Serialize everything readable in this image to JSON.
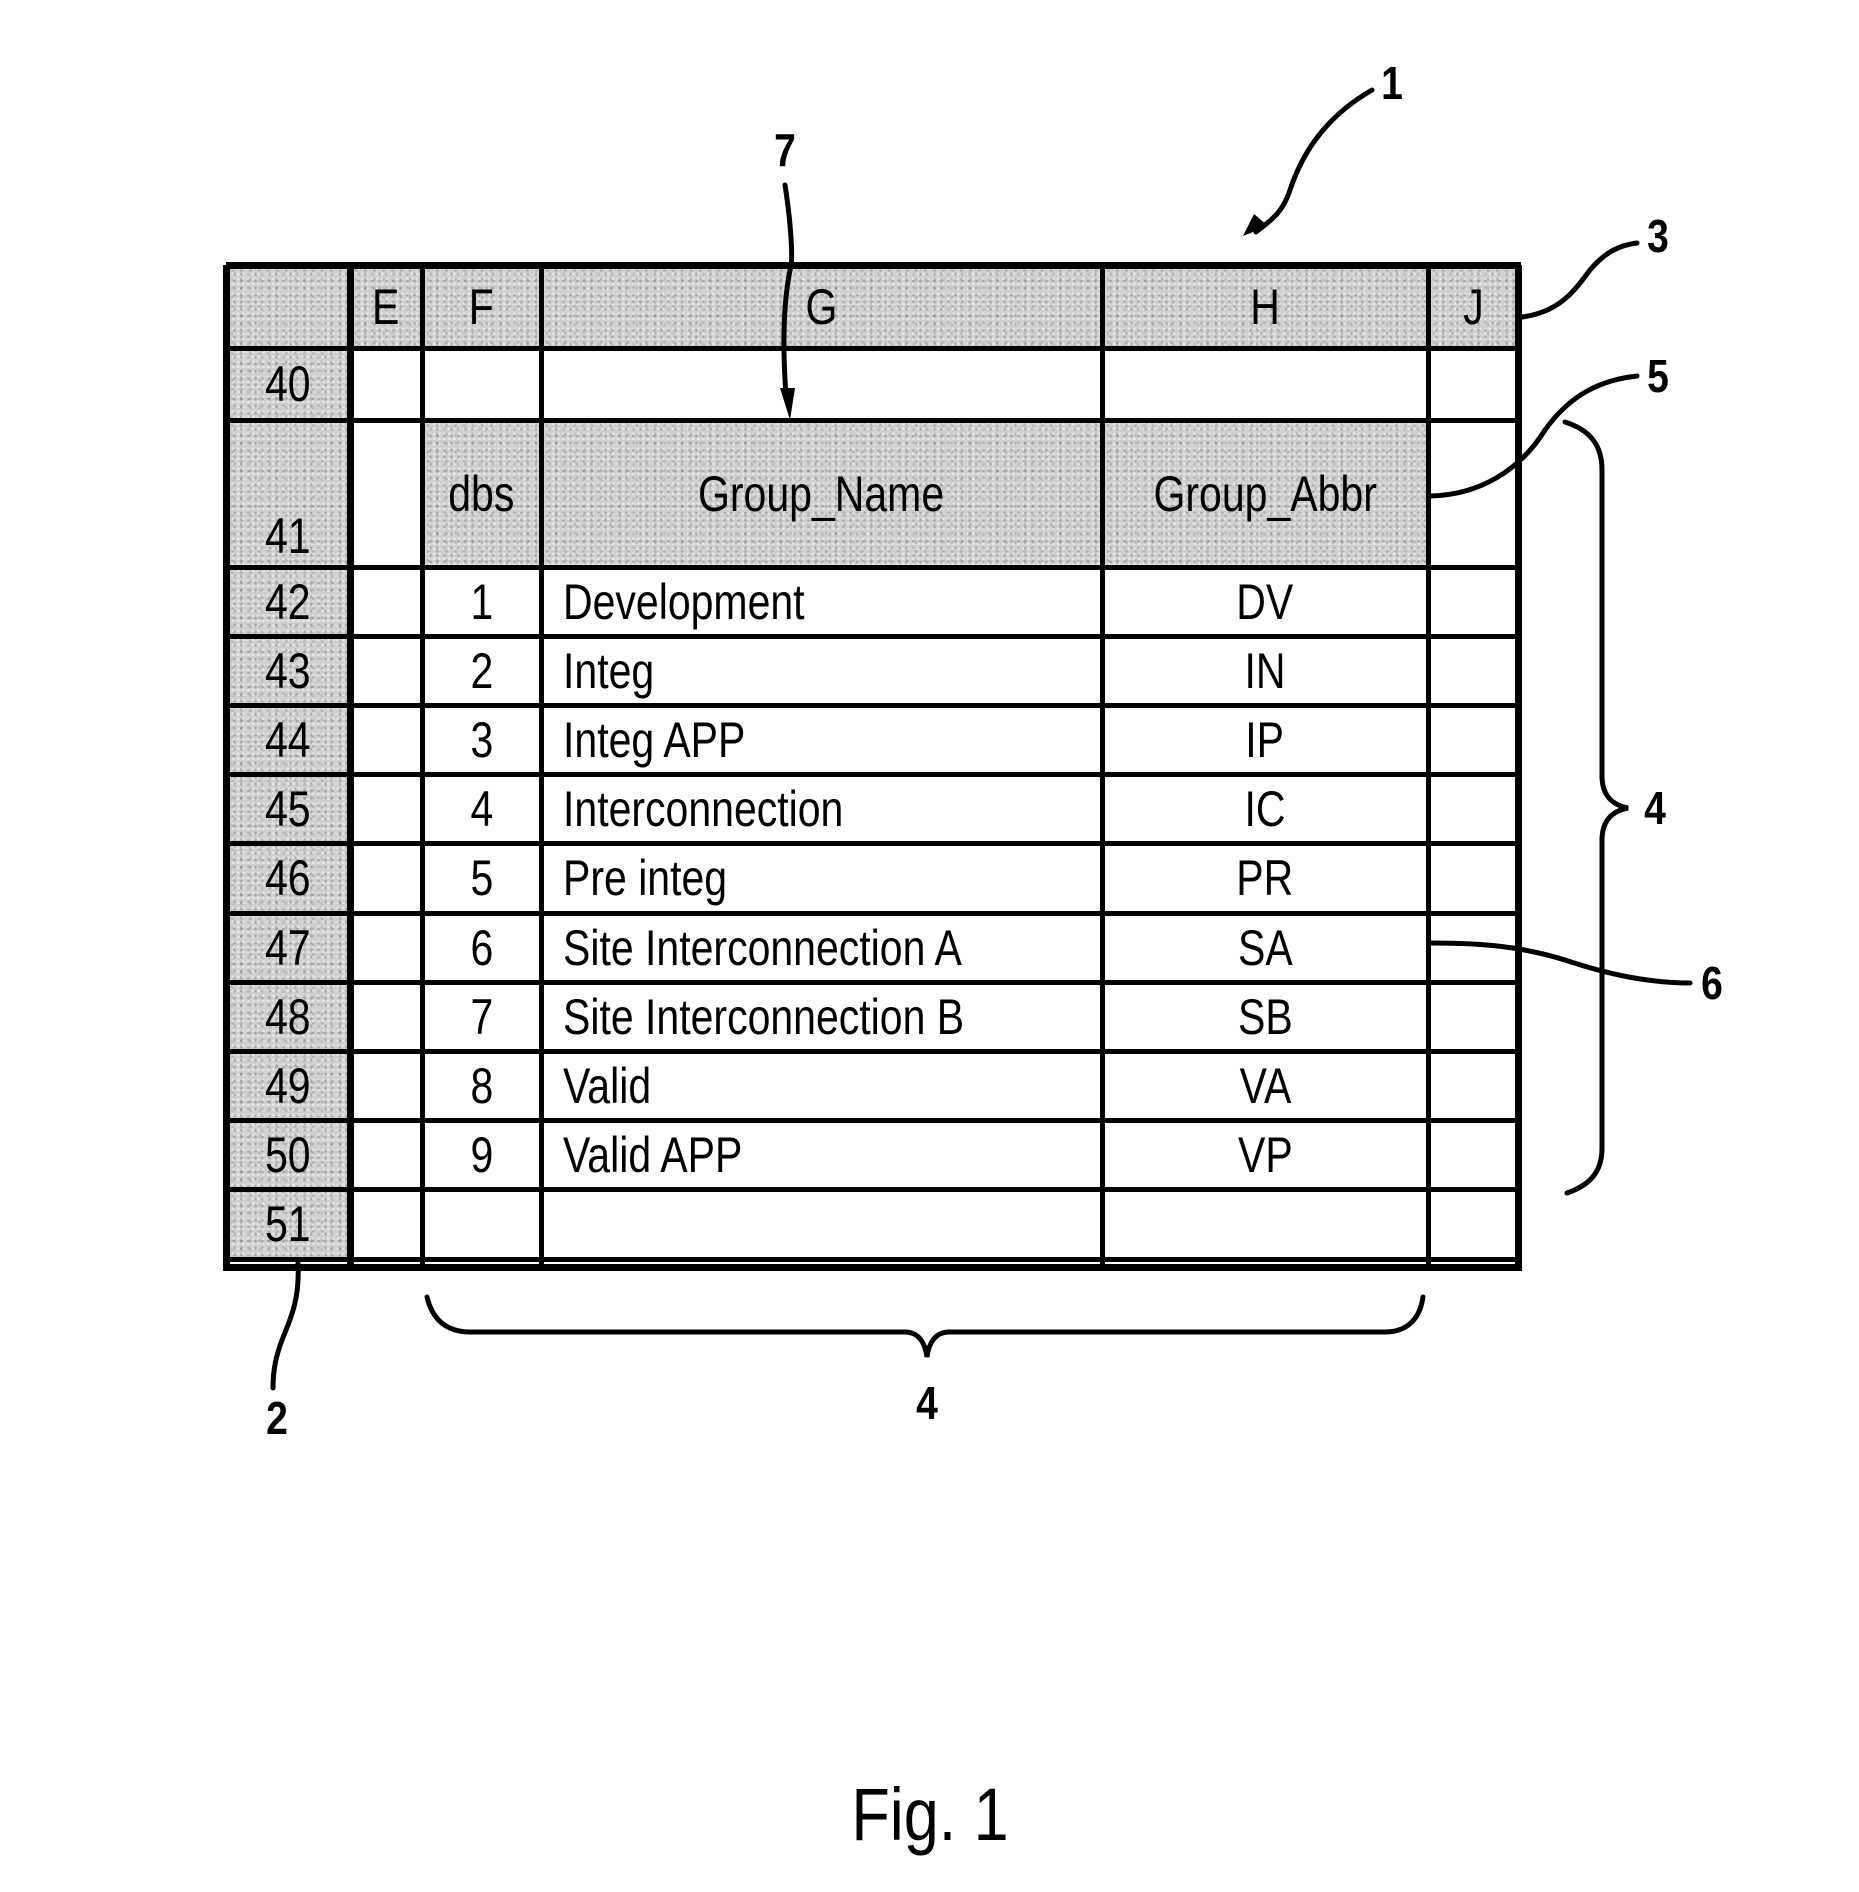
{
  "figure": {
    "caption": "Fig. 1",
    "reference_numerals": {
      "sheet": "1",
      "row_header": "2",
      "column_header": "3",
      "table_range_right": "4",
      "table_range_bottom": "4",
      "column_name_cell": "5",
      "data_row": "6",
      "header_row": "7"
    }
  },
  "spreadsheet": {
    "corner_label": "",
    "column_headers": [
      "E",
      "F",
      "G",
      "H",
      "J"
    ],
    "rows": [
      {
        "row_number": "40",
        "cells": [
          "",
          "",
          "",
          "",
          ""
        ]
      },
      {
        "row_number": "41",
        "cells": [
          "",
          "dbs",
          "Group_Name",
          "Group_Abbr",
          ""
        ],
        "is_table_header": true
      },
      {
        "row_number": "42",
        "cells": [
          "",
          "1",
          "Development",
          "DV",
          ""
        ]
      },
      {
        "row_number": "43",
        "cells": [
          "",
          "2",
          "Integ",
          "IN",
          ""
        ]
      },
      {
        "row_number": "44",
        "cells": [
          "",
          "3",
          "Integ APP",
          "IP",
          ""
        ]
      },
      {
        "row_number": "45",
        "cells": [
          "",
          "4",
          "Interconnection",
          "IC",
          ""
        ]
      },
      {
        "row_number": "46",
        "cells": [
          "",
          "5",
          "Pre integ",
          "PR",
          ""
        ]
      },
      {
        "row_number": "47",
        "cells": [
          "",
          "6",
          "Site Interconnection A",
          "SA",
          ""
        ]
      },
      {
        "row_number": "48",
        "cells": [
          "",
          "7",
          "Site Interconnection B",
          "SB",
          ""
        ]
      },
      {
        "row_number": "49",
        "cells": [
          "",
          "8",
          "Valid",
          "VA",
          ""
        ]
      },
      {
        "row_number": "50",
        "cells": [
          "",
          "9",
          "Valid APP",
          "VP",
          ""
        ]
      },
      {
        "row_number": "51",
        "cells": [
          "",
          "",
          "",
          "",
          ""
        ]
      }
    ]
  }
}
